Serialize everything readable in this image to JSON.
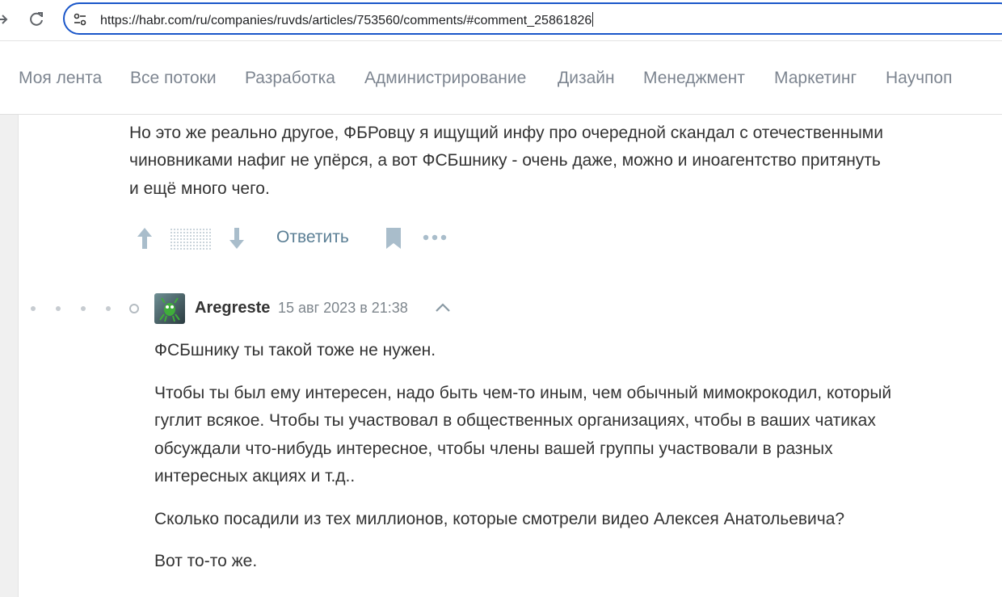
{
  "browser": {
    "url": "https://habr.com/ru/companies/ruvds/articles/753560/comments/#comment_25861826"
  },
  "nav": {
    "items": [
      {
        "label": "Моя лента"
      },
      {
        "label": "Все потоки"
      },
      {
        "label": "Разработка"
      },
      {
        "label": "Администрирование"
      },
      {
        "label": "Дизайн"
      },
      {
        "label": "Менеджмент"
      },
      {
        "label": "Маркетинг"
      },
      {
        "label": "Научпоп"
      }
    ]
  },
  "comment1": {
    "lines": [
      "Но это же реально другое, ФБРовцу я ищущий инфу про очередной скандал с отечественными",
      "чиновниками нафиг не упёрся, а вот ФСБшнику - очень даже, можно и иноагентство притянуть",
      "и ещё много чего."
    ],
    "reply_label": "Ответить"
  },
  "comment2": {
    "author": "Aregreste",
    "date": "15 авг 2023 в 21:38",
    "paragraphs": [
      {
        "lines": [
          "ФСБшнику ты такой тоже не нужен."
        ]
      },
      {
        "lines": [
          "Чтобы ты был ему интересен, надо быть чем-то иным, чем обычный мимокрокодил, который",
          "гуглит всякое. Чтобы ты участвовал в общественных организациях, чтобы в ваших чатиках",
          "обсуждали что-нибудь интересное, чтобы члены вашей группы участвовали в разных",
          "интересных акциях и т.д.."
        ]
      },
      {
        "lines": [
          "Сколько посадили из тех миллионов, которые смотрели видео Алексея Анатольевича?"
        ]
      },
      {
        "lines": [
          "Вот то-то же."
        ]
      }
    ]
  },
  "colors": {
    "accent": "#1a56c9",
    "link": "#5b7f95",
    "text": "#333333",
    "muted": "#7d8590"
  }
}
